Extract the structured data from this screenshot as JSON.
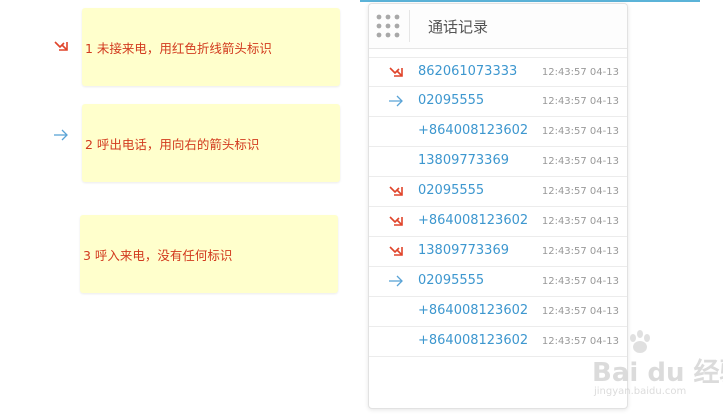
{
  "notes": [
    {
      "text": "1 未接来电，用红色折线箭头标识",
      "icon": "missed-call-icon"
    },
    {
      "text": "2 呼出电话，用向右的箭头标识",
      "icon": "outgoing-call-icon"
    },
    {
      "text": "3 呼入来电，没有任何标识",
      "icon": ""
    }
  ],
  "panel": {
    "title": "通话记录",
    "menu_icon": "grid-dots-icon"
  },
  "calls": [
    {
      "type": "missed",
      "icon": "missed-call-icon",
      "number": "862061073333",
      "time": "12:43:57 04-13"
    },
    {
      "type": "outgoing",
      "icon": "outgoing-call-icon",
      "number": "02095555",
      "time": "12:43:57 04-13"
    },
    {
      "type": "incoming",
      "icon": "",
      "number": "+864008123602",
      "time": "12:43:57 04-13"
    },
    {
      "type": "incoming",
      "icon": "",
      "number": "13809773369",
      "time": "12:43:57 04-13"
    },
    {
      "type": "missed",
      "icon": "missed-call-icon",
      "number": "02095555",
      "time": "12:43:57 04-13"
    },
    {
      "type": "missed",
      "icon": "missed-call-icon",
      "number": "+864008123602",
      "time": "12:43:57 04-13"
    },
    {
      "type": "missed",
      "icon": "missed-call-icon",
      "number": "13809773369",
      "time": "12:43:57 04-13"
    },
    {
      "type": "outgoing",
      "icon": "outgoing-call-icon",
      "number": "02095555",
      "time": "12:43:57 04-13"
    },
    {
      "type": "incoming",
      "icon": "",
      "number": "+864008123602",
      "time": "12:43:57 04-13"
    },
    {
      "type": "incoming",
      "icon": "",
      "number": "+864008123602",
      "time": "12:43:57 04-13"
    }
  ],
  "watermark": {
    "brand": "Bai du 经验",
    "url": "jingyan.baidu.com"
  },
  "colors": {
    "missed": "#e0442a",
    "outgoing": "#5aa3d6",
    "number": "#3d97cf",
    "note_bg": "#ffffcc",
    "note_text": "#d23a1e"
  }
}
